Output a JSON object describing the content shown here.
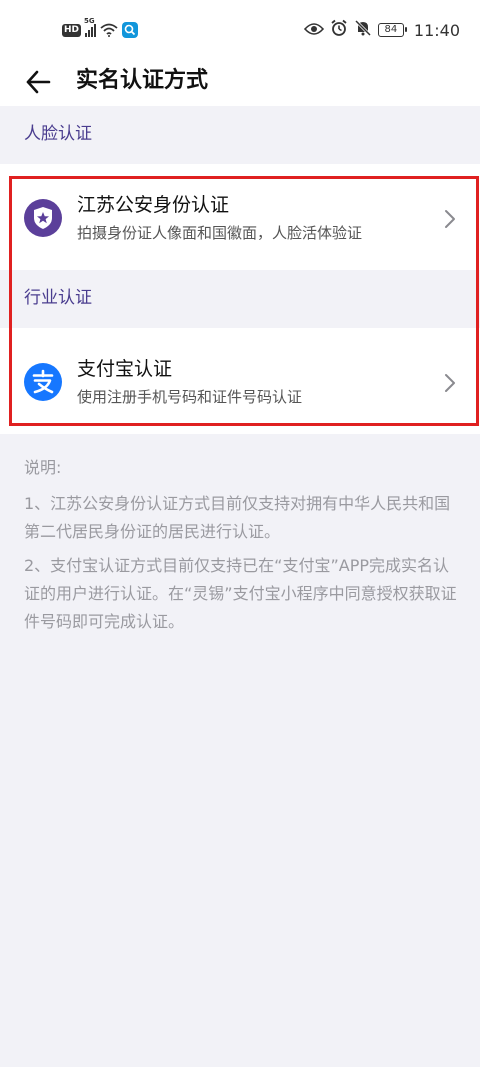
{
  "status_bar": {
    "hd_label": "HD",
    "network_label": "5G",
    "battery_level": "84",
    "time": "11:40",
    "icons": [
      "hd-icon",
      "signal-icon",
      "wifi-icon",
      "search-app-icon",
      "eye-icon",
      "alarm-icon",
      "mute-icon",
      "battery-icon"
    ]
  },
  "header": {
    "title": "实名认证方式"
  },
  "sections": [
    {
      "title": "人脸认证",
      "items": [
        {
          "title": "江苏公安身份认证",
          "subtitle": "拍摄身份证人像面和国徽面，人脸活体验证",
          "icon": "police-badge-icon"
        }
      ]
    },
    {
      "title": "行业认证",
      "items": [
        {
          "title": "支付宝认证",
          "subtitle": "使用注册手机号码和证件号码认证",
          "icon": "alipay-icon"
        }
      ]
    }
  ],
  "notes": {
    "heading": "说明:",
    "items": [
      "1、江苏公安身份认证方式目前仅支持对拥有中华人民共和国第二代居民身份证的居民进行认证。",
      "2、支付宝认证方式目前仅支持已在“支付宝”APP完成实名认证的用户进行认证。在“灵锡”支付宝小程序中同意授权获取证件号码即可完成认证。"
    ]
  },
  "colors": {
    "background": "#f2f2f7",
    "section_title": "#4a3d8f",
    "police_icon": "#5b3f9a",
    "alipay_icon": "#1677ff",
    "highlight": "#e02020",
    "note_text": "#9a9aa0"
  }
}
